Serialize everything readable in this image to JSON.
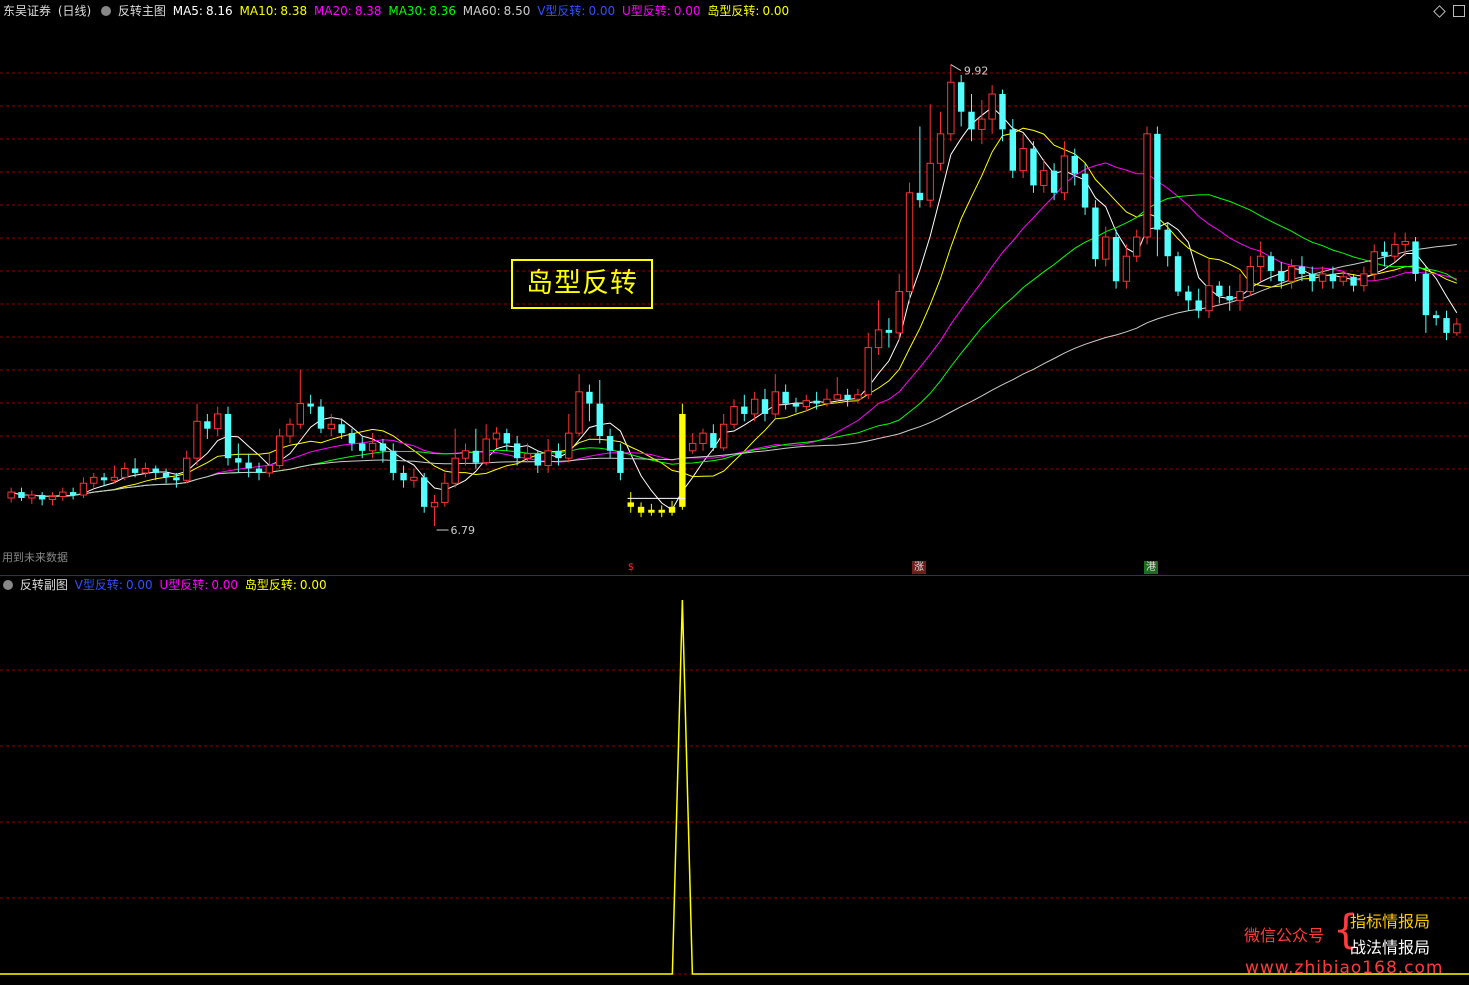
{
  "header": {
    "stock_name": "东吴证券",
    "period": "(日线)",
    "indicator": "反转主图",
    "ma5": {
      "label": "MA5:",
      "value": "8.16",
      "color": "#ffffff"
    },
    "ma10": {
      "label": "MA10:",
      "value": "8.38",
      "color": "#ffff00"
    },
    "ma20": {
      "label": "MA20:",
      "value": "8.38",
      "color": "#ff00ff"
    },
    "ma30": {
      "label": "MA30:",
      "value": "8.36",
      "color": "#00ff00"
    },
    "ma60": {
      "label": "MA60:",
      "value": "8.50",
      "color": "#cccccc"
    },
    "v_rev": {
      "label": "V型反转:",
      "value": "0.00",
      "color": "#0000ff"
    },
    "u_rev": {
      "label": "U型反转:",
      "value": "0.00",
      "color": "#ff00ff"
    },
    "island_rev": {
      "label": "岛型反转:",
      "value": "0.00",
      "color": "#ffff00"
    }
  },
  "sub_header": {
    "indicator": "反转副图",
    "v_rev": {
      "label": "V型反转:",
      "value": "0.00",
      "color": "#0000ff"
    },
    "u_rev": {
      "label": "U型反转:",
      "value": "0.00",
      "color": "#ff00ff"
    },
    "island_rev": {
      "label": "岛型反转:",
      "value": "0.00",
      "color": "#ffff00"
    }
  },
  "annotations": {
    "high_price": "9.92",
    "low_price": "6.79",
    "future_data_note": "用到未来数据",
    "pattern_box": "岛型反转"
  },
  "event_markers": [
    {
      "text": "$",
      "color": "#ff3030"
    },
    {
      "text": "涨",
      "color": "#ffffff"
    },
    {
      "text": "港",
      "color": "#ffffff"
    }
  ],
  "watermark": {
    "wechat": "微信公众号",
    "line1": "指标情报局",
    "line2": "战法情报局",
    "url": "www.zhibiao168.com"
  },
  "colors": {
    "up": "#ff3232",
    "down": "#54ffff",
    "island": "#ffff00",
    "grid": "#8b0000"
  },
  "chart_data": [
    {
      "type": "candlestick",
      "title": "反转主图",
      "ylim": [
        6.6,
        10.1
      ],
      "annotations": [
        {
          "label": "9.92",
          "kind": "high"
        },
        {
          "label": "6.79",
          "kind": "low"
        }
      ],
      "candles": [
        [
          6.98,
          7.02,
          6.95,
          7.05
        ],
        [
          7.02,
          6.98,
          6.96,
          7.05
        ],
        [
          6.98,
          7.0,
          6.94,
          7.03
        ],
        [
          7.0,
          6.97,
          6.93,
          7.02
        ],
        [
          6.97,
          6.99,
          6.93,
          7.02
        ],
        [
          6.99,
          7.02,
          6.96,
          7.05
        ],
        [
          7.02,
          7.0,
          6.97,
          7.05
        ],
        [
          7.0,
          7.08,
          6.98,
          7.12
        ],
        [
          7.08,
          7.12,
          7.05,
          7.15
        ],
        [
          7.12,
          7.1,
          7.06,
          7.15
        ],
        [
          7.1,
          7.12,
          7.08,
          7.2
        ],
        [
          7.12,
          7.18,
          7.1,
          7.22
        ],
        [
          7.18,
          7.15,
          7.12,
          7.25
        ],
        [
          7.15,
          7.18,
          7.12,
          7.22
        ],
        [
          7.18,
          7.15,
          7.1,
          7.2
        ],
        [
          7.15,
          7.12,
          7.08,
          7.18
        ],
        [
          7.12,
          7.1,
          7.05,
          7.15
        ],
        [
          7.1,
          7.25,
          7.08,
          7.3
        ],
        [
          7.25,
          7.5,
          7.2,
          7.62
        ],
        [
          7.5,
          7.45,
          7.38,
          7.55
        ],
        [
          7.45,
          7.55,
          7.4,
          7.6
        ],
        [
          7.55,
          7.25,
          7.2,
          7.6
        ],
        [
          7.25,
          7.22,
          7.15,
          7.35
        ],
        [
          7.22,
          7.18,
          7.12,
          7.28
        ],
        [
          7.18,
          7.15,
          7.1,
          7.22
        ],
        [
          7.15,
          7.2,
          7.12,
          7.28
        ],
        [
          7.2,
          7.4,
          7.18,
          7.45
        ],
        [
          7.4,
          7.48,
          7.35,
          7.52
        ],
        [
          7.48,
          7.62,
          7.45,
          7.85
        ],
        [
          7.62,
          7.6,
          7.55,
          7.68
        ],
        [
          7.6,
          7.45,
          7.42,
          7.65
        ],
        [
          7.45,
          7.48,
          7.4,
          7.55
        ],
        [
          7.48,
          7.42,
          7.38,
          7.52
        ],
        [
          7.42,
          7.35,
          7.3,
          7.45
        ],
        [
          7.35,
          7.3,
          7.25,
          7.4
        ],
        [
          7.3,
          7.35,
          7.25,
          7.42
        ],
        [
          7.35,
          7.3,
          7.22,
          7.38
        ],
        [
          7.3,
          7.15,
          7.1,
          7.35
        ],
        [
          7.15,
          7.1,
          7.05,
          7.2
        ],
        [
          7.1,
          7.12,
          7.05,
          7.18
        ],
        [
          7.12,
          6.92,
          6.88,
          7.15
        ],
        [
          6.92,
          6.95,
          6.79,
          7.0
        ],
        [
          6.95,
          7.08,
          6.92,
          7.15
        ],
        [
          7.08,
          7.25,
          7.05,
          7.45
        ],
        [
          7.25,
          7.3,
          7.2,
          7.35
        ],
        [
          7.3,
          7.22,
          7.18,
          7.45
        ],
        [
          7.22,
          7.38,
          7.2,
          7.48
        ],
        [
          7.38,
          7.42,
          7.32,
          7.46
        ],
        [
          7.42,
          7.35,
          7.3,
          7.45
        ],
        [
          7.35,
          7.25,
          7.2,
          7.4
        ],
        [
          7.25,
          7.28,
          7.22,
          7.35
        ],
        [
          7.28,
          7.2,
          7.15,
          7.3
        ],
        [
          7.2,
          7.3,
          7.15,
          7.38
        ],
        [
          7.3,
          7.25,
          7.2,
          7.35
        ],
        [
          7.25,
          7.42,
          7.22,
          7.55
        ],
        [
          7.42,
          7.7,
          7.4,
          7.82
        ],
        [
          7.7,
          7.62,
          7.5,
          7.75
        ],
        [
          7.62,
          7.4,
          7.35,
          7.78
        ],
        [
          7.4,
          7.3,
          7.25,
          7.45
        ],
        [
          7.3,
          7.15,
          7.1,
          7.35
        ],
        [
          6.95,
          6.92,
          6.88,
          7.02
        ],
        [
          6.92,
          6.88,
          6.85,
          6.95
        ],
        [
          6.88,
          6.9,
          6.86,
          6.94
        ],
        [
          6.9,
          6.88,
          6.85,
          6.93
        ],
        [
          6.88,
          6.92,
          6.86,
          6.96
        ],
        [
          6.92,
          7.55,
          6.9,
          7.62
        ],
        [
          7.3,
          7.35,
          7.28,
          7.42
        ],
        [
          7.35,
          7.42,
          7.3,
          7.45
        ],
        [
          7.42,
          7.32,
          7.3,
          7.48
        ],
        [
          7.32,
          7.48,
          7.3,
          7.55
        ],
        [
          7.48,
          7.6,
          7.45,
          7.65
        ],
        [
          7.6,
          7.55,
          7.5,
          7.68
        ],
        [
          7.55,
          7.65,
          7.5,
          7.7
        ],
        [
          7.65,
          7.55,
          7.5,
          7.72
        ],
        [
          7.55,
          7.7,
          7.52,
          7.82
        ],
        [
          7.7,
          7.62,
          7.58,
          7.75
        ],
        [
          7.62,
          7.6,
          7.56,
          7.66
        ],
        [
          7.6,
          7.64,
          7.57,
          7.68
        ],
        [
          7.64,
          7.62,
          7.58,
          7.7
        ],
        [
          7.62,
          7.65,
          7.6,
          7.72
        ],
        [
          7.65,
          7.68,
          7.62,
          7.8
        ],
        [
          7.68,
          7.65,
          7.6,
          7.72
        ],
        [
          7.65,
          7.68,
          7.62,
          7.72
        ],
        [
          7.68,
          8.0,
          7.65,
          8.1
        ],
        [
          8.0,
          8.12,
          7.95,
          8.32
        ],
        [
          8.12,
          8.1,
          8.0,
          8.2
        ],
        [
          8.1,
          8.38,
          8.05,
          8.5
        ],
        [
          8.38,
          9.05,
          8.3,
          9.12
        ],
        [
          9.05,
          9.0,
          8.95,
          9.5
        ],
        [
          9.0,
          9.25,
          8.95,
          9.65
        ],
        [
          9.25,
          9.45,
          9.2,
          9.6
        ],
        [
          9.45,
          9.8,
          9.4,
          9.92
        ],
        [
          9.8,
          9.6,
          9.5,
          9.85
        ],
        [
          9.6,
          9.48,
          9.4,
          9.72
        ],
        [
          9.48,
          9.55,
          9.38,
          9.68
        ],
        [
          9.55,
          9.72,
          9.45,
          9.78
        ],
        [
          9.72,
          9.48,
          9.4,
          9.75
        ],
        [
          9.48,
          9.2,
          9.15,
          9.55
        ],
        [
          9.2,
          9.35,
          9.15,
          9.45
        ],
        [
          9.35,
          9.1,
          9.05,
          9.4
        ],
        [
          9.1,
          9.2,
          9.05,
          9.28
        ],
        [
          9.2,
          9.05,
          9.0,
          9.25
        ],
        [
          9.05,
          9.3,
          9.0,
          9.4
        ],
        [
          9.3,
          9.18,
          9.1,
          9.35
        ],
        [
          9.18,
          8.95,
          8.9,
          9.25
        ],
        [
          8.95,
          8.6,
          8.55,
          9.0
        ],
        [
          8.6,
          8.75,
          8.55,
          8.82
        ],
        [
          8.75,
          8.45,
          8.4,
          8.8
        ],
        [
          8.45,
          8.62,
          8.4,
          8.7
        ],
        [
          8.62,
          8.75,
          8.58,
          8.8
        ],
        [
          8.75,
          9.45,
          8.7,
          9.5
        ],
        [
          9.45,
          8.8,
          8.62,
          9.5
        ],
        [
          8.8,
          8.62,
          8.55,
          8.85
        ],
        [
          8.62,
          8.38,
          8.35,
          8.65
        ],
        [
          8.38,
          8.32,
          8.25,
          8.42
        ],
        [
          8.32,
          8.25,
          8.2,
          8.4
        ],
        [
          8.25,
          8.42,
          8.2,
          8.6
        ],
        [
          8.42,
          8.35,
          8.3,
          8.45
        ],
        [
          8.35,
          8.32,
          8.25,
          8.42
        ],
        [
          8.32,
          8.38,
          8.25,
          8.5
        ],
        [
          8.38,
          8.55,
          8.35,
          8.62
        ],
        [
          8.55,
          8.62,
          8.45,
          8.72
        ],
        [
          8.62,
          8.52,
          8.45,
          8.65
        ],
        [
          8.52,
          8.45,
          8.4,
          8.58
        ],
        [
          8.45,
          8.55,
          8.4,
          8.6
        ],
        [
          8.55,
          8.5,
          8.45,
          8.62
        ],
        [
          8.5,
          8.45,
          8.38,
          8.55
        ],
        [
          8.45,
          8.5,
          8.4,
          8.55
        ],
        [
          8.5,
          8.45,
          8.4,
          8.55
        ],
        [
          8.45,
          8.48,
          8.42,
          8.52
        ],
        [
          8.48,
          8.42,
          8.38,
          8.5
        ],
        [
          8.42,
          8.5,
          8.38,
          8.55
        ],
        [
          8.5,
          8.65,
          8.45,
          8.7
        ],
        [
          8.65,
          8.62,
          8.55,
          8.72
        ],
        [
          8.62,
          8.7,
          8.58,
          8.78
        ],
        [
          8.7,
          8.72,
          8.62,
          8.78
        ],
        [
          8.72,
          8.5,
          8.45,
          8.75
        ],
        [
          8.5,
          8.22,
          8.1,
          8.55
        ],
        [
          8.22,
          8.2,
          8.15,
          8.25
        ],
        [
          8.2,
          8.1,
          8.05,
          8.25
        ],
        [
          8.1,
          8.16,
          8.08,
          8.2
        ]
      ],
      "island_range": [
        60,
        64
      ],
      "series": [
        {
          "name": "MA5",
          "color": "#ffffff"
        },
        {
          "name": "MA10",
          "color": "#ffff00"
        },
        {
          "name": "MA20",
          "color": "#ff00ff"
        },
        {
          "name": "MA30",
          "color": "#00ff00"
        },
        {
          "name": "MA60",
          "color": "#cccccc"
        }
      ]
    },
    {
      "type": "line",
      "title": "反转副图",
      "ylim": [
        0,
        1
      ],
      "series": [
        {
          "name": "岛型反转",
          "color": "#ffff00",
          "spike_index": 65,
          "spike_value": 1.0
        }
      ]
    }
  ]
}
